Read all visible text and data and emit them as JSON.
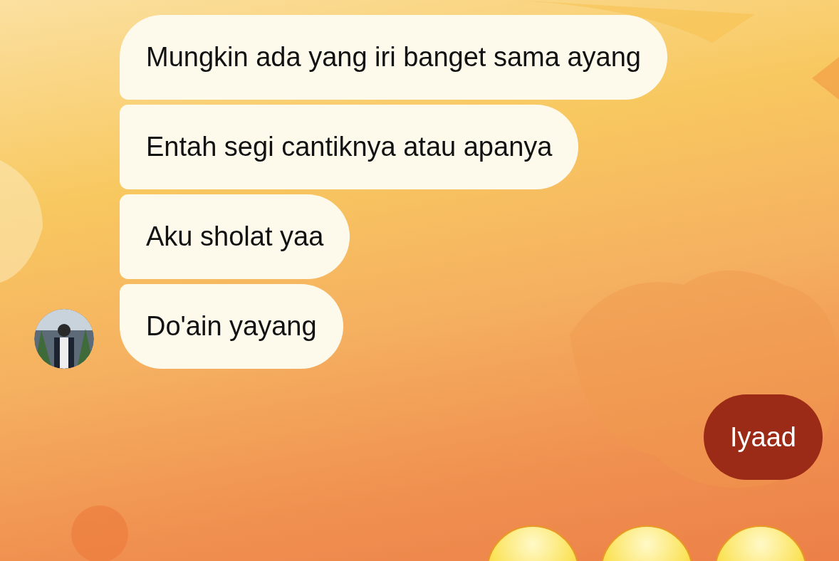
{
  "conversation": [
    {
      "kind": "incoming",
      "messages": [
        "Mungkin ada yang iri banget sama ayang",
        "Entah segi cantiknya atau apanya",
        "Aku sholat yaa",
        "Do'ain yayang"
      ]
    },
    {
      "kind": "outgoing",
      "messages": [
        "Iyaad"
      ]
    }
  ]
}
